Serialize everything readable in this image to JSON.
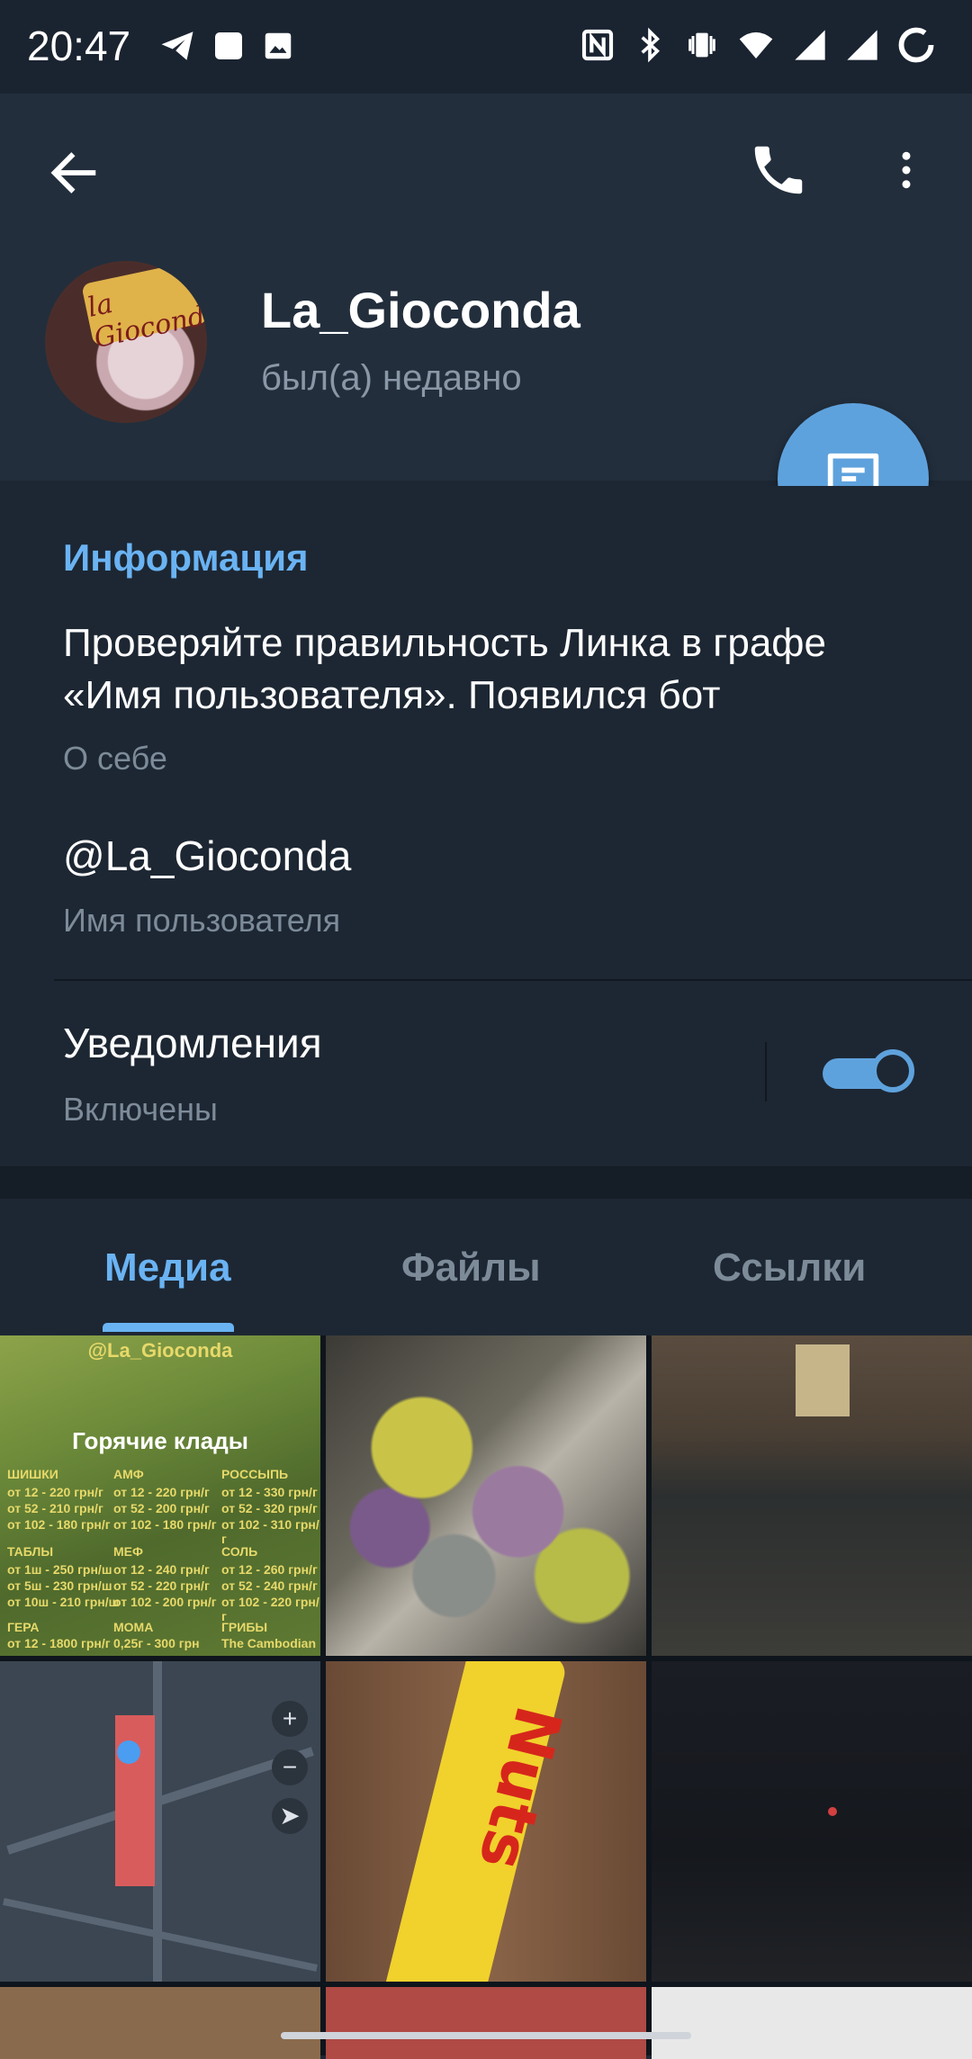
{
  "status_bar": {
    "time": "20:47",
    "left_icons": [
      "telegram-icon",
      "square-icon",
      "image-icon"
    ],
    "right_icons": [
      "nfc-icon",
      "bluetooth-icon",
      "vibrate-icon",
      "wifi-icon",
      "signal-icon",
      "signal-icon",
      "battery-icon"
    ]
  },
  "header": {
    "back_icon": "arrow-left-icon",
    "call_icon": "phone-icon",
    "more_icon": "more-vertical-icon",
    "avatar_text": "la Gioconda",
    "name": "La_Gioconda",
    "last_seen": "был(а) недавно",
    "fab_icon": "message-icon"
  },
  "info": {
    "section_title": "Информация",
    "bio": "Проверяйте правильность Линка в графе «Имя пользователя». Появился бот",
    "bio_label": "О себе",
    "username": "@La_Gioconda",
    "username_label": "Имя пользователя",
    "notifications_label": "Уведомления",
    "notifications_state": "Включены",
    "notifications_enabled": true
  },
  "tabs": [
    {
      "label": "Медиа",
      "active": true
    },
    {
      "label": "Файлы",
      "active": false
    },
    {
      "label": "Ссылки",
      "active": false
    }
  ],
  "media": {
    "price_list": {
      "handle": "@La_Gioconda",
      "heading": "Горячие клады",
      "columns": [
        {
          "title": "ШИШКИ",
          "lines": [
            "от 12 - 220 грн/г",
            "от 52 - 210 грн/г",
            "от 102 - 180 грн/г"
          ]
        },
        {
          "title": "АМФ",
          "lines": [
            "от 12 - 220 грн/г",
            "от 52 - 200 грн/г",
            "от 102 - 180 грн/г"
          ]
        },
        {
          "title": "РОССЫПЬ",
          "lines": [
            "от 12 - 330 грн/г",
            "от 52 - 320 грн/г",
            "от 102 - 310 грн/г"
          ]
        },
        {
          "title": "ТАБЛЫ",
          "lines": [
            "от 1ш - 250 грн/ш",
            "от 5ш - 230 грн/ш",
            "от 10ш - 210 грн/ш"
          ]
        },
        {
          "title": "МЕФ",
          "lines": [
            "от 12 - 240 грн/г",
            "от 52 - 220 грн/г",
            "от 102 - 200 грн/г"
          ]
        },
        {
          "title": "СОЛЬ",
          "lines": [
            "от 12 - 260 грн/г",
            "от 52 - 240 грн/г",
            "от 102 - 220 грн/г"
          ]
        },
        {
          "title": "ГЕРА",
          "lines": [
            "от 12 - 1800 грн/г"
          ]
        },
        {
          "title": "МОМА",
          "lines": [
            "0,25г - 300 грн"
          ]
        },
        {
          "title": "ГРИБЫ",
          "lines": [
            "The Cambodian"
          ]
        }
      ]
    },
    "candy_brand": "Nuts",
    "map_zoom_in": "+",
    "map_zoom_out": "−"
  },
  "colors": {
    "accent": "#6ab3f3",
    "fab": "#5ea2dd",
    "background": "#1d2733",
    "header": "#222e3c"
  }
}
